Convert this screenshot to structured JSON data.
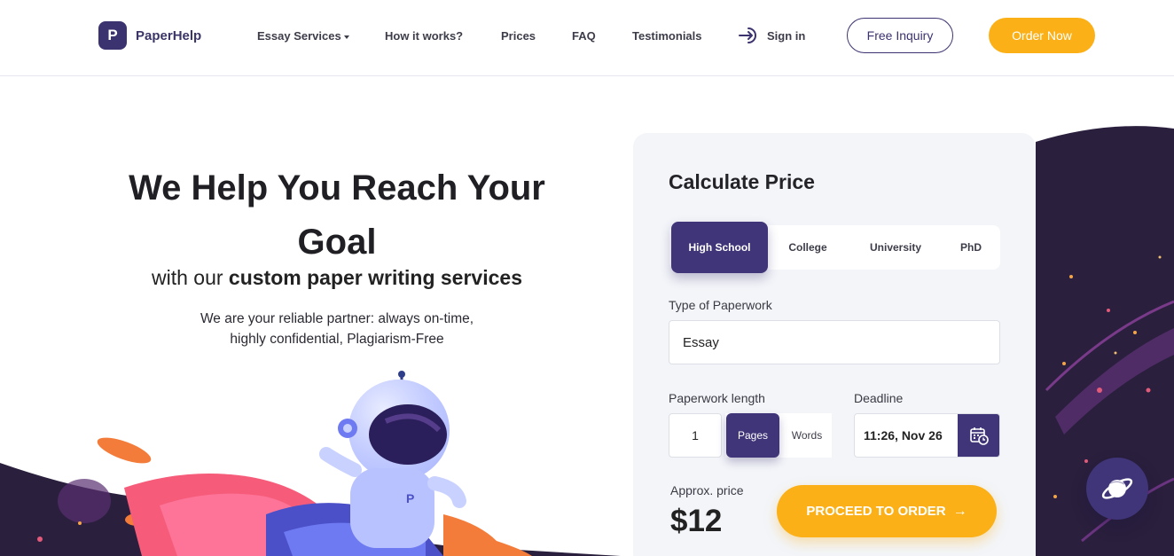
{
  "header": {
    "logo_letter": "P",
    "logo_text": "PaperHelp",
    "nav": {
      "essay_services": "Essay Services",
      "how_it_works": "How it works?",
      "prices": "Prices",
      "faq": "FAQ",
      "testimonials": "Testimonials"
    },
    "signin_label": "Sign in",
    "inquiry_label": "Free Inquiry",
    "order_label": "Order Now"
  },
  "hero": {
    "title": "We Help You Reach Your Goal",
    "subtitle_light": "with our",
    "subtitle_bold": "custom paper writing services",
    "desc_line1": "We are your reliable partner: always on-time,",
    "desc_line2": "highly confidential, Plagiarism-Free",
    "astronaut_badge": "P"
  },
  "calculator": {
    "title": "Calculate Price",
    "levels": [
      "High School",
      "College",
      "University",
      "PhD"
    ],
    "active_level": "High School",
    "type_label": "Type of Paperwork",
    "type_value": "Essay",
    "length_label": "Paperwork length",
    "length_value": "1",
    "units": [
      "Pages",
      "Words"
    ],
    "active_unit": "Pages",
    "deadline_label": "Deadline",
    "deadline_value": "11:26, Nov 26",
    "approx_label": "Approx. price",
    "approx_price": "$12",
    "proceed_label": "PROCEED TO ORDER",
    "proceed_arrow": "→"
  },
  "colors": {
    "brand_purple": "#3f3578",
    "accent_yellow": "#fbb017",
    "card_bg": "#f3f5f9",
    "space_dark": "#2a1f3d"
  },
  "icons": {
    "signin": "sign-in-arrow-icon",
    "calendar": "calendar-clock-icon",
    "planet": "planet-icon"
  }
}
